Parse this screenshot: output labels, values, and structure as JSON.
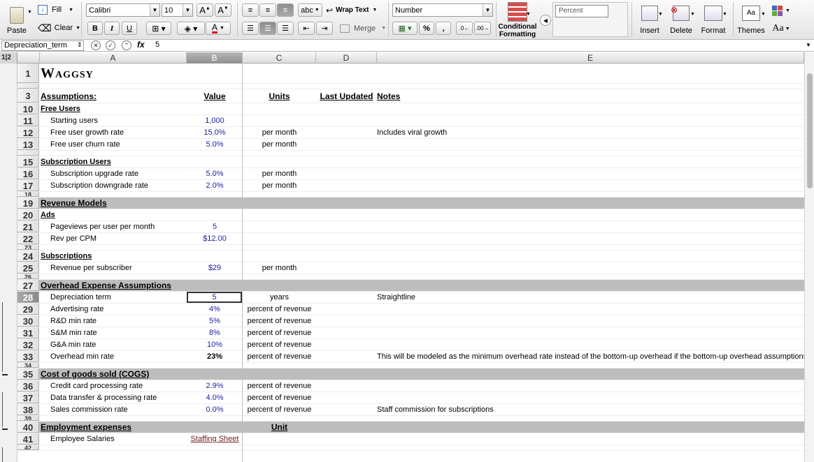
{
  "ribbon": {
    "paste": "Paste",
    "fill": "Fill",
    "clear": "Clear",
    "font_name": "Calibri",
    "font_size": "10",
    "bold": "B",
    "italic": "I",
    "underline": "U",
    "abc": "abc",
    "wrap_text": "Wrap Text",
    "merge": "Merge",
    "number_format": "Number",
    "percent": "%",
    "comma": ",",
    "conditional_formatting_1": "Conditional",
    "conditional_formatting_2": "Formatting",
    "cell_style": "Percent",
    "insert": "Insert",
    "delete": "Delete",
    "format": "Format",
    "themes": "Themes",
    "aa": "Aa"
  },
  "formula_bar": {
    "name_box": "Depreciation_term",
    "fx": "fx",
    "value": "5"
  },
  "outline_levels": "1|2",
  "columns": [
    "A",
    "B",
    "C",
    "D",
    "E"
  ],
  "rows": [
    {
      "n": "1",
      "A": "Waggsy",
      "style": "title"
    },
    {
      "n": "",
      "style": "thin"
    },
    {
      "n": "3",
      "A": "Assumptions:",
      "B": "Value",
      "C": "Units",
      "D": "Last Updated",
      "E": "Notes",
      "style": "header"
    },
    {
      "n": "10",
      "A": "Free Users",
      "style": "sub"
    },
    {
      "n": "11",
      "A": "Starting users",
      "B": "1,000"
    },
    {
      "n": "12",
      "A": "Free user growth rate",
      "B": "15.0%",
      "C": "per month",
      "E": "Includes viral growth"
    },
    {
      "n": "13",
      "A": "Free user churn rate",
      "B": "5.0%",
      "C": "per month"
    },
    {
      "n": "",
      "style": "thin"
    },
    {
      "n": "15",
      "A": "Subscription Users",
      "style": "sub"
    },
    {
      "n": "16",
      "A": "Subscription upgrade rate",
      "B": "5.0%",
      "C": "per month"
    },
    {
      "n": "17",
      "A": "Subscription downgrade rate",
      "B": "2.0%",
      "C": "per month"
    },
    {
      "n": "18",
      "style": "thin"
    },
    {
      "n": "19",
      "A": "Revenue Models",
      "style": "section"
    },
    {
      "n": "20",
      "A": "Ads",
      "style": "sub"
    },
    {
      "n": "21",
      "A": "Pageviews per user per month",
      "B": "5"
    },
    {
      "n": "22",
      "A": "Rev per CPM",
      "B": "$12.00"
    },
    {
      "n": "23",
      "style": "thin"
    },
    {
      "n": "24",
      "A": "Subscriptions",
      "style": "sub"
    },
    {
      "n": "25",
      "A": "Revenue per subscriber",
      "B": "$29",
      "C": "per month"
    },
    {
      "n": "26",
      "style": "thin"
    },
    {
      "n": "27",
      "A": "Overhead Expense Assumptions",
      "style": "section"
    },
    {
      "n": "28",
      "A": "Depreciation term",
      "B": "5",
      "C": "years",
      "E": "Straightline",
      "style": "selected"
    },
    {
      "n": "29",
      "A": "Advertising rate",
      "B": "4%",
      "C": "percent of revenue"
    },
    {
      "n": "30",
      "A": "R&D min rate",
      "B": "5%",
      "C": "percent of revenue"
    },
    {
      "n": "31",
      "A": "S&M min rate",
      "B": "8%",
      "C": "percent of revenue"
    },
    {
      "n": "32",
      "A": "G&A min rate",
      "B": "10%",
      "C": "percent of revenue"
    },
    {
      "n": "33",
      "A": "Overhead min rate",
      "B": "23%",
      "C": "percent of revenue",
      "E": "This will be modeled as the minimum overhead rate instead of the bottom-up overhead if the bottom-up overhead assumptions",
      "style": "boldval"
    },
    {
      "n": "34",
      "style": "thin"
    },
    {
      "n": "35",
      "A": "Cost of goods sold (COGS)",
      "style": "section"
    },
    {
      "n": "36",
      "A": "Credit card processing rate",
      "B": "2.9%",
      "C": "percent of revenue"
    },
    {
      "n": "37",
      "A": "Data transfer & processing rate",
      "B": "4.0%",
      "C": "percent of revenue"
    },
    {
      "n": "38",
      "A": "Sales commission rate",
      "B": "0.0%",
      "C": "percent of revenue",
      "E": "Staff commission for subscriptions"
    },
    {
      "n": "39",
      "style": "thin"
    },
    {
      "n": "40",
      "A": "Employment expenses",
      "C": "Unit",
      "style": "section"
    },
    {
      "n": "41",
      "A": "Employee Salaries",
      "B": "Staffing Sheet",
      "style": "link"
    },
    {
      "n": "42",
      "style": "partial"
    }
  ]
}
